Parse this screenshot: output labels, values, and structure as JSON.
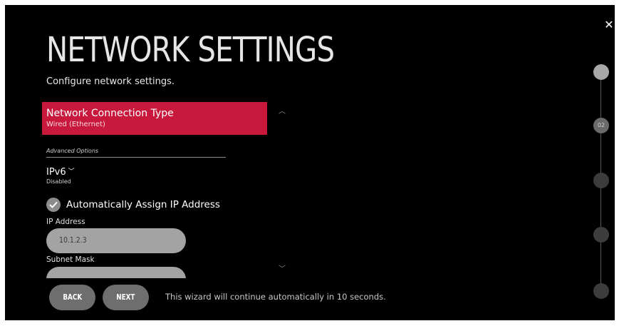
{
  "header": {
    "title": "NETWORK SETTINGS",
    "subtitle": "Configure network settings.",
    "close_icon": "close-icon"
  },
  "connection_type": {
    "label": "Network Connection Type",
    "value": "Wired (Ethernet)"
  },
  "advanced": {
    "heading": "Advanced Options",
    "ipv6": {
      "label": "IPv6",
      "value": "Disabled"
    },
    "auto_assign": {
      "label": "Automatically Assign IP Address",
      "checked": true
    },
    "ip_address": {
      "label": "IP Address",
      "value": "10.1.2.3"
    },
    "subnet_mask": {
      "label": "Subnet Mask",
      "value": ""
    }
  },
  "footer": {
    "back_label": "BACK",
    "next_label": "NEXT",
    "note": "This wizard will continue automatically in 10 seconds."
  },
  "steps": {
    "current_label": "02",
    "total": 5,
    "current": 2
  },
  "colors": {
    "accent": "#c8193c",
    "background": "#000000",
    "field": "#a3a3a3",
    "button": "#6e6e6e"
  }
}
